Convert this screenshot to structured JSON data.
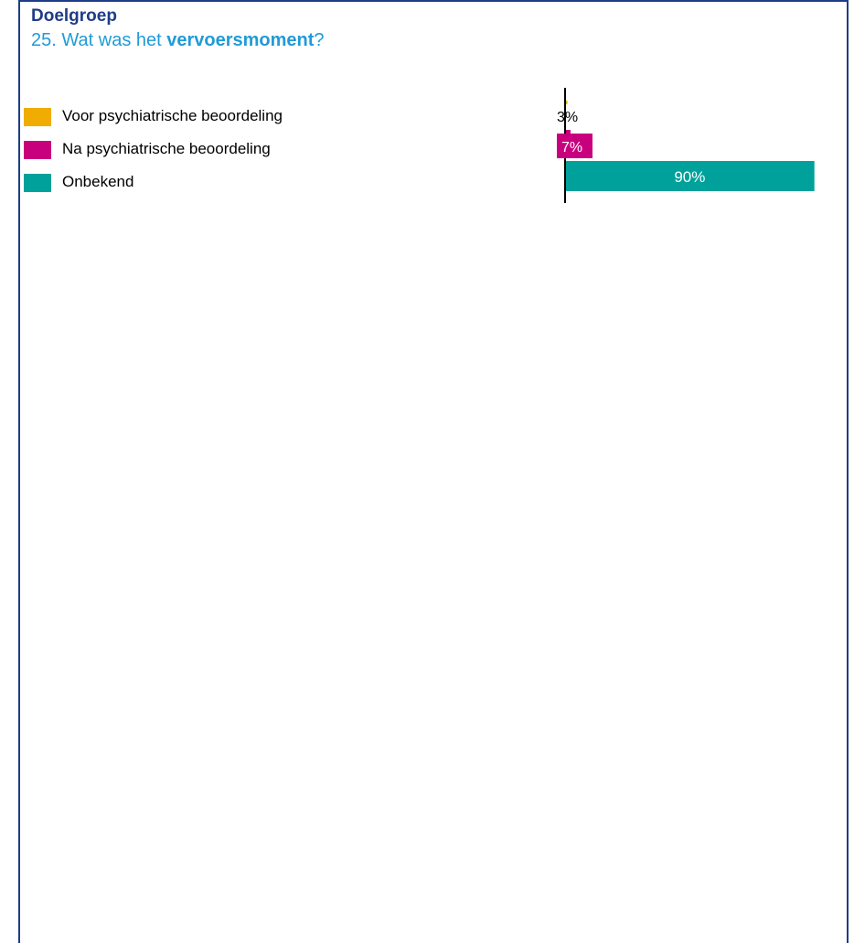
{
  "header": {
    "section": "Doelgroep",
    "question_number": "25.",
    "question_prefix": "Wat was het",
    "question_bold": "vervoersmoment",
    "question_suffix": "?"
  },
  "colors": {
    "frame": "#1f3c88",
    "section_title": "#1f3c88",
    "question": "#1f9bd7"
  },
  "chart_data": {
    "type": "bar",
    "orientation": "horizontal",
    "categories": [
      "Voor psychiatrische beoordeling",
      "Na psychiatrische beoordeling",
      "Onbekend"
    ],
    "values": [
      3,
      7,
      90
    ],
    "value_labels": [
      "3%",
      "7%",
      "90%"
    ],
    "colors": [
      "#f0ac00",
      "#c8007d",
      "#00a19a"
    ],
    "xlim": [
      0,
      100
    ],
    "grid": false,
    "legend": "left",
    "title": "",
    "xlabel": "",
    "ylabel": ""
  }
}
